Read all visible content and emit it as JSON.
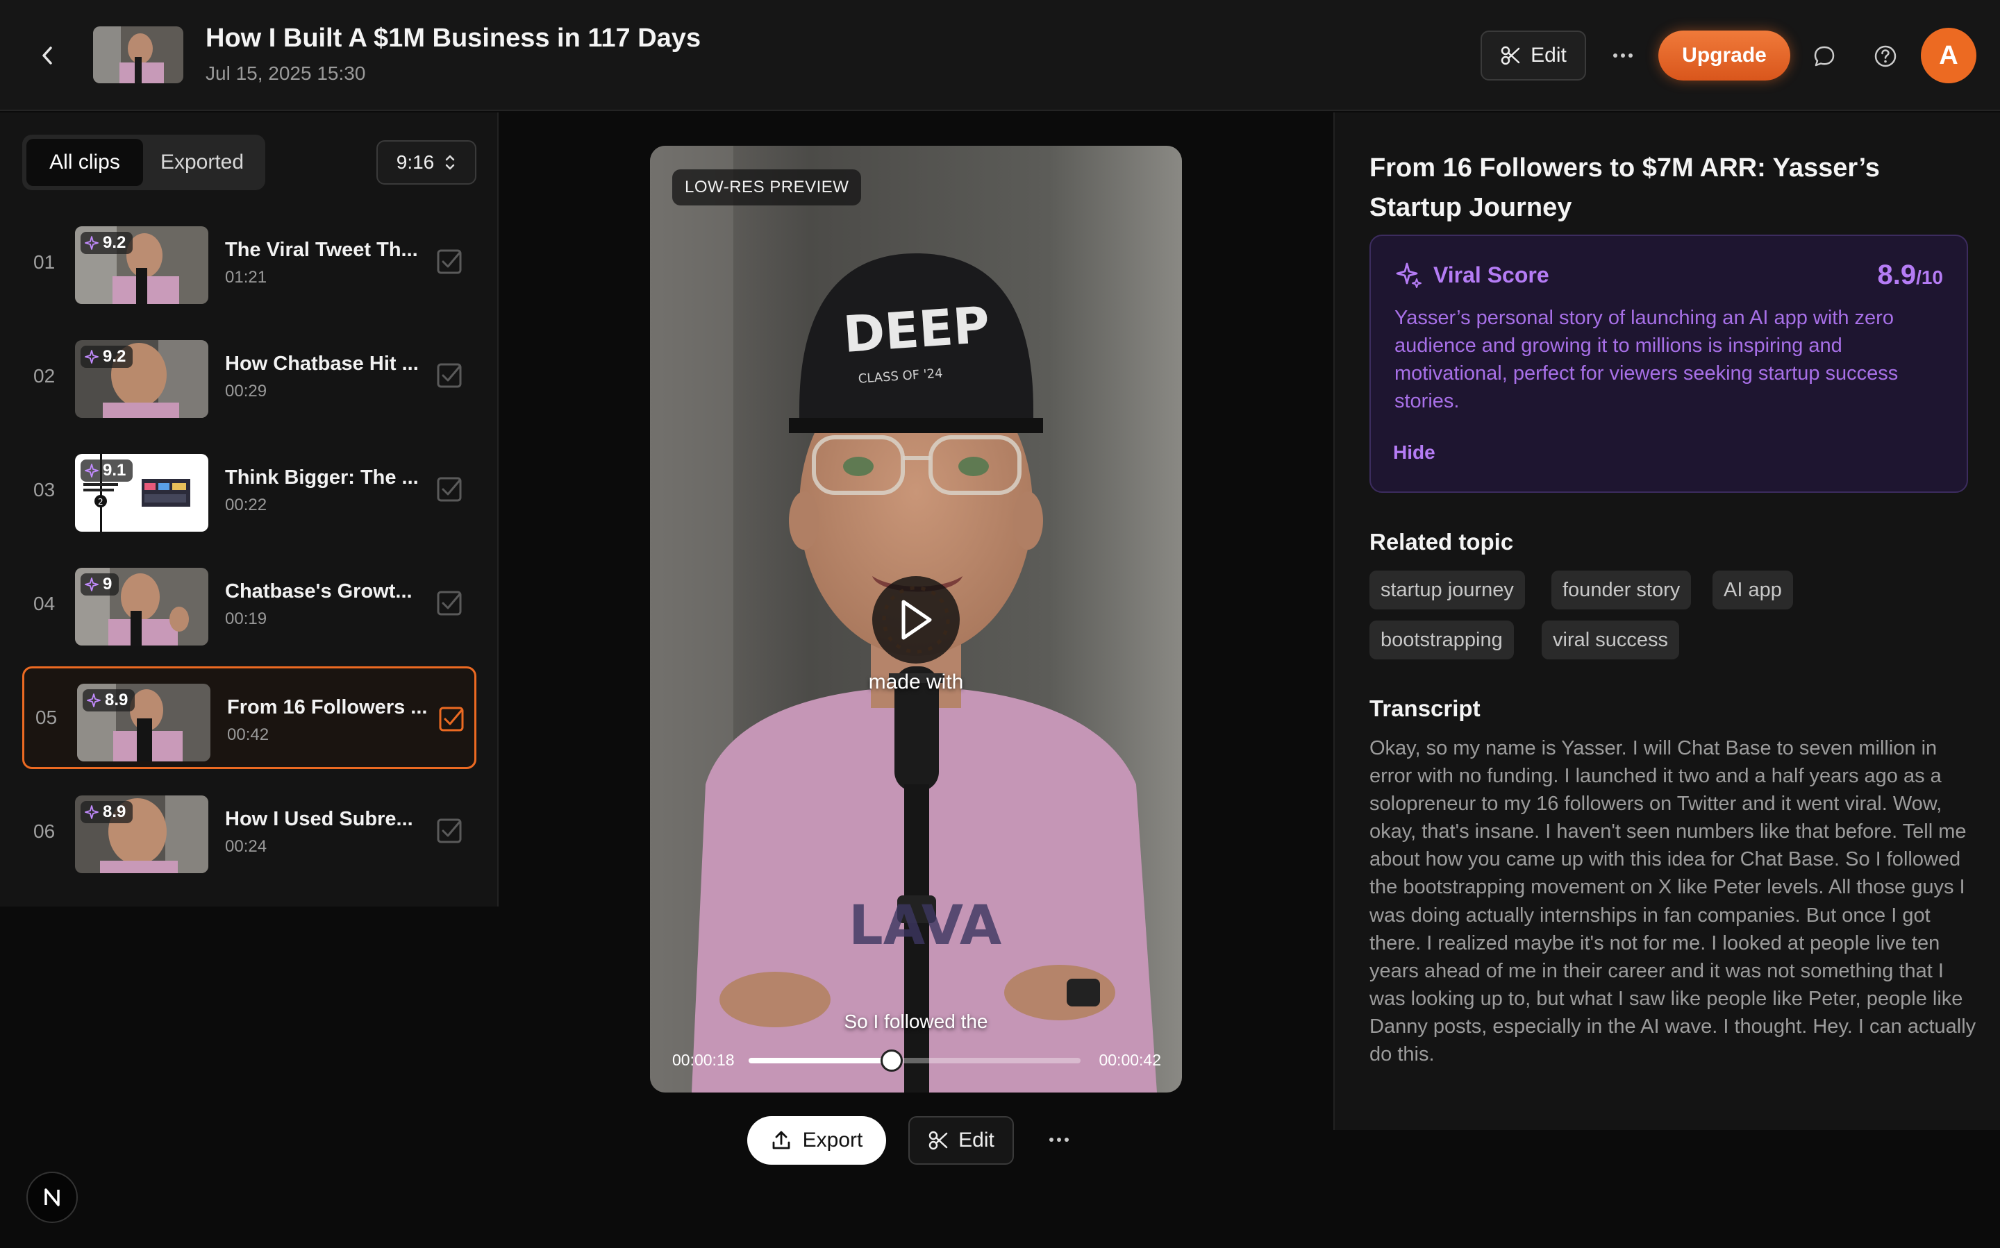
{
  "header": {
    "title": "How I Built A $1M Business in 117 Days",
    "date": "Jul 15, 2025 15:30",
    "edit_label": "Edit",
    "upgrade_label": "Upgrade",
    "avatar_letter": "A",
    "accent": "#ec6a22"
  },
  "left": {
    "tabs": {
      "all": "All clips",
      "exported": "Exported"
    },
    "ratio": "9:16",
    "clips": [
      {
        "num": "01",
        "score": "9.2",
        "title": "The Viral Tweet Th...",
        "duration": "01:21"
      },
      {
        "num": "02",
        "score": "9.2",
        "title": "How Chatbase Hit ...",
        "duration": "00:29"
      },
      {
        "num": "03",
        "score": "9.1",
        "title": "Think Bigger: The ...",
        "duration": "00:22"
      },
      {
        "num": "04",
        "score": "9",
        "title": "Chatbase's Growt...",
        "duration": "00:19"
      },
      {
        "num": "05",
        "score": "8.9",
        "title": "From 16 Followers ...",
        "duration": "00:42"
      },
      {
        "num": "06",
        "score": "8.9",
        "title": "How I Used Subre...",
        "duration": "00:24"
      }
    ],
    "selected_index": 4
  },
  "player": {
    "preview_badge": "LOW-RES PREVIEW",
    "caption_mid": "made with",
    "caption_bottom": "So I followed the",
    "current_time": "00:00:18",
    "total_time": "00:00:42",
    "progress": 0.43,
    "export_label": "Export",
    "edit_label": "Edit"
  },
  "right": {
    "title": "From 16 Followers to $7M ARR: Yasser’s Startup Journey",
    "viral": {
      "label": "Viral Score",
      "score": "8.9",
      "score_max": "/10",
      "description": "Yasser’s personal story of launching an AI app with zero audience and growing it to millions is inspiring and motivational, perfect for viewers seeking startup success stories.",
      "hide_label": "Hide",
      "color": "#b57cf5"
    },
    "related_heading": "Related topic",
    "topics": [
      "startup journey",
      "founder story",
      "AI app",
      "bootstrapping",
      "viral success"
    ],
    "transcript_heading": "Transcript",
    "transcript": "Okay, so my name is Yasser. I will Chat Base to seven million in error with no funding. I launched it two and a half years ago as a solopreneur to my 16 followers on Twitter and it went viral. Wow, okay, that's insane. I haven't seen numbers like that before. Tell me about how you came up with this idea for Chat Base. So I followed the bootstrapping movement on X like Peter levels. All those guys I was doing actually internships in fan companies. But once I got there. I realized maybe it's not for me. I looked at people live ten years ahead of me in their career and it was not something that I was looking up to, but what I saw like people like Peter, people like Danny posts, especially in the AI wave. I thought. Hey. I can actually do this."
  },
  "footer": {
    "badge_letter": "N"
  }
}
